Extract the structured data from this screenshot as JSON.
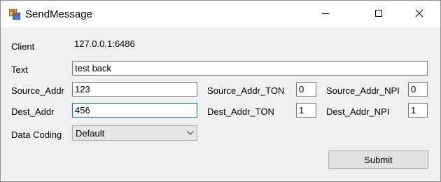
{
  "window": {
    "title": "SendMessage"
  },
  "form": {
    "client_label": "Client",
    "client_value": "127.0.0.1:6486",
    "text_label": "Text",
    "text_value": "test back",
    "source_addr_label": "Source_Addr",
    "source_addr_value": "123",
    "source_addr_ton_label": "Source_Addr_TON",
    "source_addr_ton_value": "0",
    "source_addr_npi_label": "Source_Addr_NPI",
    "source_addr_npi_value": "0",
    "dest_addr_label": "Dest_Addr",
    "dest_addr_value": "456",
    "dest_addr_ton_label": "Dest_Addr_TON",
    "dest_addr_ton_value": "1",
    "dest_addr_npi_label": "Dest_Addr_NPI",
    "dest_addr_npi_value": "1",
    "data_coding_label": "Data Coding",
    "data_coding_selected": "Default",
    "submit_label": "Submit"
  },
  "colors": {
    "focus_border": "#0078d7",
    "window_bg": "#f0f0f0",
    "titlebar_bg": "#ffffff"
  },
  "icons": {
    "app": "app-window-icon",
    "minimize": "minimize-icon",
    "maximize": "maximize-icon",
    "close": "close-icon",
    "dropdown": "chevron-down-icon"
  }
}
